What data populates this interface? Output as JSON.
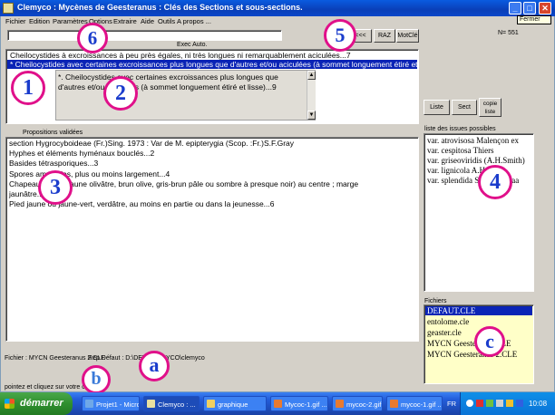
{
  "window": {
    "title": "Clemyco :  Mycènes de Geesteranus : Clés des Sections et sous-sections.",
    "tooltip": "Fermer"
  },
  "menu": [
    "Fichier",
    "Edition",
    "Paramètres",
    "Options",
    "Extraire",
    "Aide",
    "Outils",
    "A propos ..."
  ],
  "toolbar": {
    "search_value": "",
    "btn_back": "<<<",
    "btn_raz": "RAZ",
    "btn_motcle": "MotClé",
    "count": "N= 551",
    "exec_auto": "Exec Auto."
  },
  "questions": {
    "items": [
      "Cheilocystides à excroissances à peu près égales, ni très longues ni remarquablement aciculées...7",
      "* Cheilocystides avec certaines excroissances plus longues que d'autres et/ou aciculées (à sommet longuement étiré et lisse)...9"
    ],
    "selected_index": 1,
    "detail": [
      "*. Cheilocystides avec certaines excroissances plus longues que",
      "d'autres et/ou aciculées (à sommet longuement étiré et lisse)...9"
    ]
  },
  "propositions": {
    "label": "Propositions validées",
    "lines": [
      "section Hygrocyboideae (Fr.)Sing. 1973 : Var de M. epipterygia (Scop. :Fr.)S.F.Gray",
      "  Hyphes et éléments hyménaux bouclés...2",
      "  Basides tétrasporiques...3",
      "  Spores amyloïdes, plus ou moins largement...4",
      "  Chapeau coloré (jaune olivâtre, brun olive, gris-brun pâle ou sombre à presque noir) au centre ; marge",
      "jaunâtre...5",
      "  Pied jaune ou jaune-vert, verdâtre, au moins en partie ou dans la jeunesse...6"
    ]
  },
  "right": {
    "btn_liste": "Liste",
    "btn_sect": "Sect",
    "btn_copie": "copie liste",
    "issues_label": "liste des issues possibles",
    "issues": [
      "var. atrovisosa Malençon ex",
      "var. cespitosa Thiers",
      "var. griseoviridis (A.H.Smith)",
      "var. lignicola A.H.Smith",
      "var. splendida Smith & Maa"
    ],
    "fichiers_label": "Fichiers",
    "fichiers": [
      "DEFAUT.CLE",
      "entolome.cle",
      "geaster.cle",
      "MYCN Geesteranus.CLE",
      "MYCN Geesteranus 2.CLE"
    ],
    "fichiers_selected": 0
  },
  "status": {
    "fichier": "Fichier : MYCN Geesteranus 2.CLE",
    "rep": "Rep.Défaut : D:\\DEV\\CLEMYCO\\clemyco",
    "hint": "pointez et cliquez sur votre choix..."
  },
  "markers": [
    "1",
    "2",
    "3",
    "4",
    "5",
    "6",
    "a",
    "b",
    "c"
  ],
  "taskbar": {
    "start": "démarrer",
    "tasks": [
      "Projet1 - Micros...",
      "Clemyco : ...",
      "graphique",
      "Mycoc-1.gif ...",
      "mycoc-2.gif ...",
      "mycoc-1.gif ..."
    ],
    "lang": "FR",
    "clock": "10:08"
  }
}
